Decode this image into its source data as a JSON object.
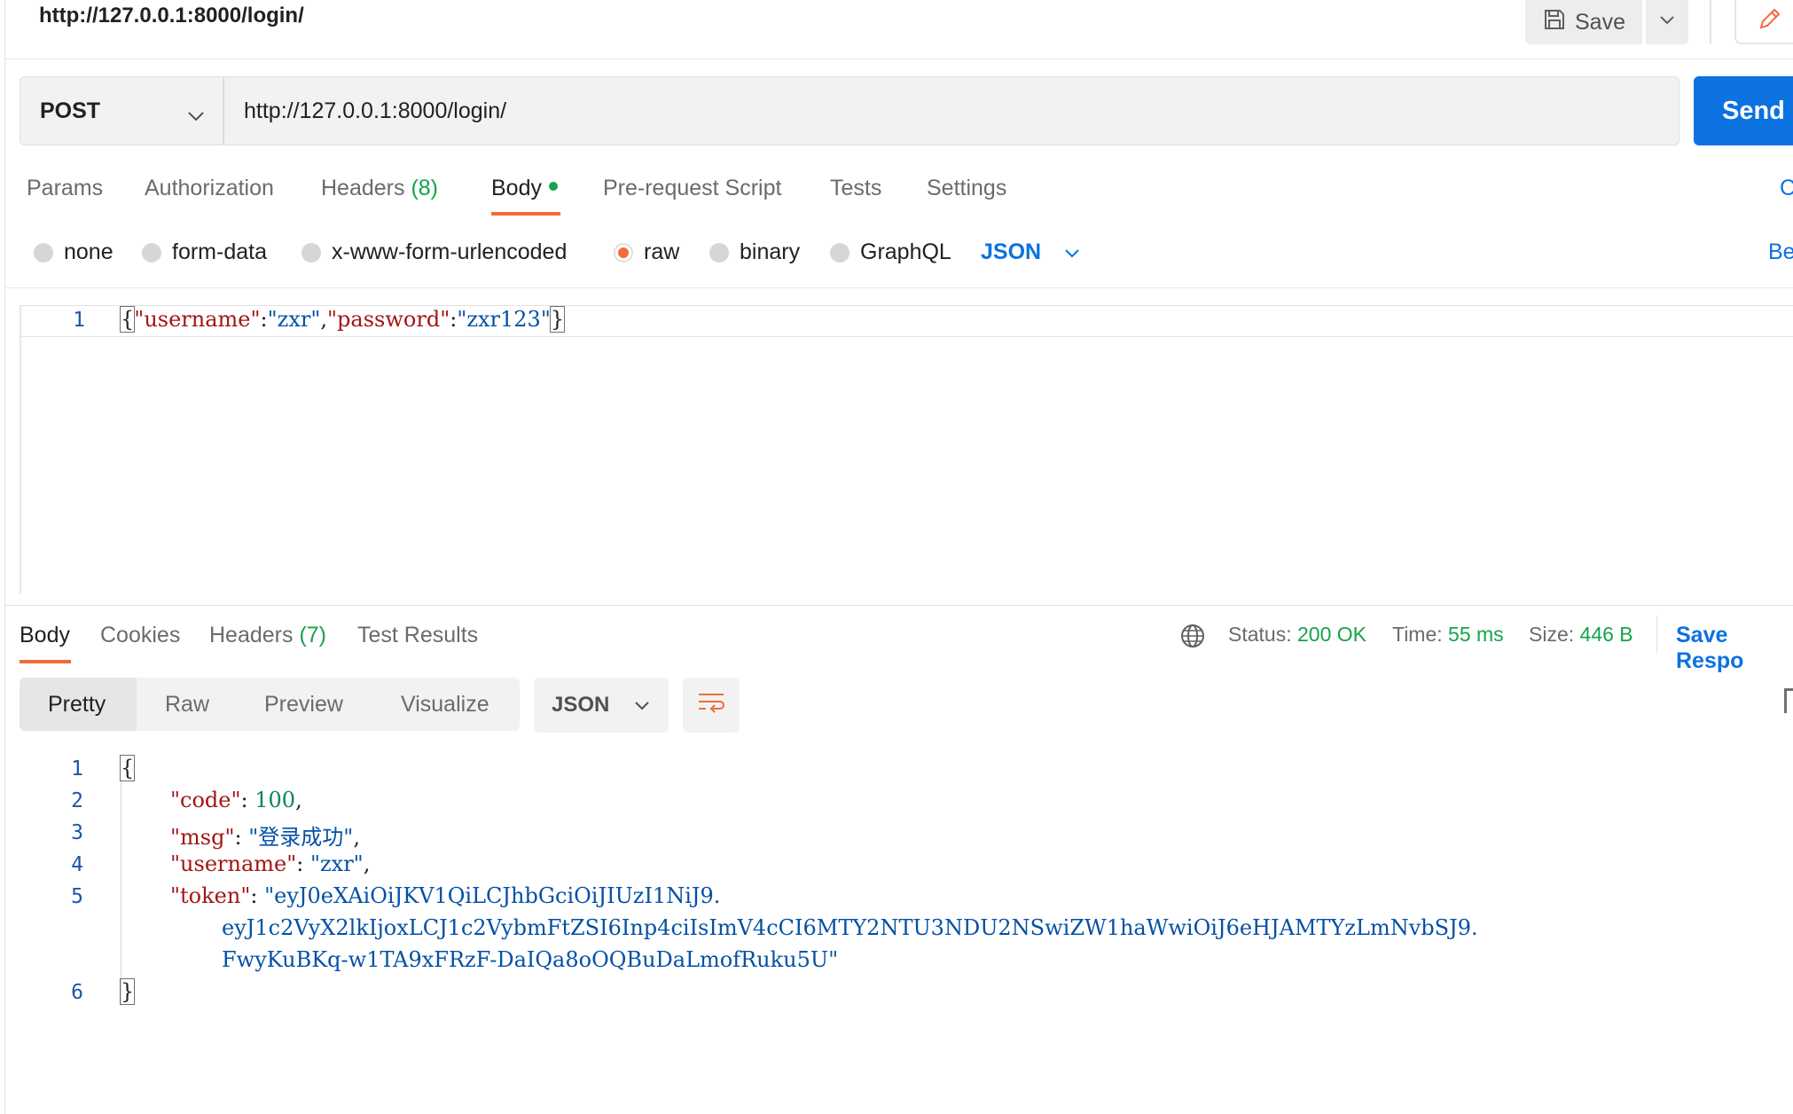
{
  "tab": {
    "title": "http://127.0.0.1:8000/login/"
  },
  "toolbar": {
    "save_label": "Save"
  },
  "request": {
    "method": "POST",
    "url": "http://127.0.0.1:8000/login/",
    "send_label": "Send"
  },
  "request_tabs": {
    "params": "Params",
    "authorization": "Authorization",
    "headers": "Headers",
    "headers_count": "(8)",
    "body": "Body",
    "pre_request": "Pre-request Script",
    "tests": "Tests",
    "settings": "Settings",
    "right_cut": "C"
  },
  "body_types": {
    "none": "none",
    "form_data": "form-data",
    "urlencoded": "x-www-form-urlencoded",
    "raw": "raw",
    "binary": "binary",
    "graphql": "GraphQL",
    "format": "JSON",
    "right_cut": "Be"
  },
  "request_body": {
    "line_number": "1",
    "open": "{",
    "k1": "\"username\"",
    "colon": ":",
    "v1": "\"zxr\"",
    "comma": ",",
    "k2": "\"password\"",
    "v2": "\"zxr123\"",
    "close": "}"
  },
  "response_tabs": {
    "body": "Body",
    "cookies": "Cookies",
    "headers": "Headers",
    "headers_count": "(7)",
    "test_results": "Test Results"
  },
  "response_status": {
    "status_label": "Status:",
    "status_value": "200 OK",
    "time_label": "Time:",
    "time_value": "55 ms",
    "size_label": "Size:",
    "size_value": "446 B",
    "save_response": "Save Respo"
  },
  "response_view": {
    "pretty": "Pretty",
    "raw": "Raw",
    "preview": "Preview",
    "visualize": "Visualize",
    "format": "JSON"
  },
  "response_body": {
    "ln1": "1",
    "ln2": "2",
    "ln3": "3",
    "ln4": "4",
    "ln5": "5",
    "ln6": "6",
    "open": "{",
    "code_key": "\"code\"",
    "code_val": "100",
    "msg_key": "\"msg\"",
    "msg_val": "\"登录成功\"",
    "username_key": "\"username\"",
    "username_val": "\"zxr\"",
    "token_key": "\"token\"",
    "token_part1": "\"eyJ0eXAiOiJKV1QiLCJhbGciOiJIUzI1NiJ9.",
    "token_part2": "eyJ1c2VyX2lkIjoxLCJ1c2VybmFtZSI6Inp4ciIsImV4cCI6MTY2NTU3NDU2NSwiZW1haWwiOiJ6eHJAMTYzLmNvbSJ9.",
    "token_part3": "FwyKuBKq-w1TA9xFRzF-DaIQa8oOQBuDaLmofRuku5U\"",
    "close": "}",
    "sep_colon": ": ",
    "sep_comma": ","
  }
}
